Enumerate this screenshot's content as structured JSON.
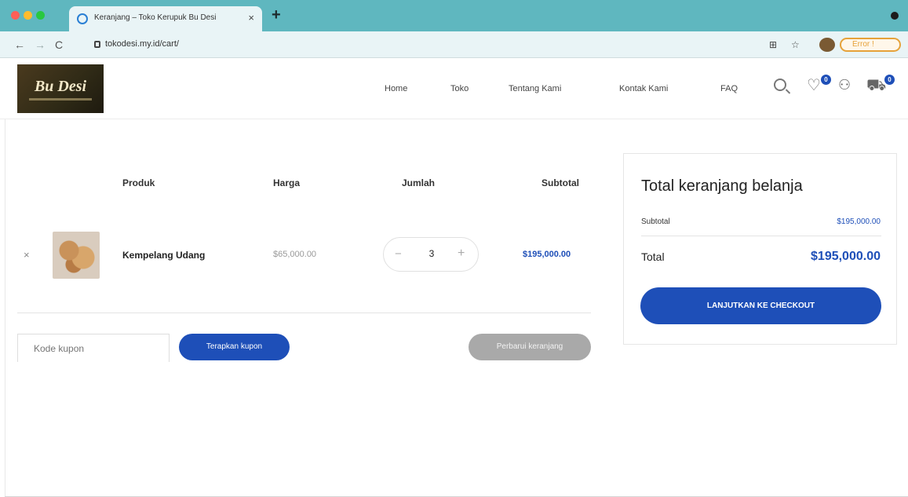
{
  "browser": {
    "tab_title": "Keranjang – Toko Kerupuk Bu Desi",
    "tab_close": "×",
    "new_tab": "+",
    "url": "tokodesi.my.id/cart/",
    "nav_back": "←",
    "nav_forward": "→",
    "nav_reload": "C",
    "error_label": "Error !",
    "icons": [
      "lock-icon",
      "translate-icon",
      "star-icon",
      "profile-avatar"
    ]
  },
  "header": {
    "logo_text": "Bu Desi",
    "menu": {
      "home": "Home",
      "toko": "Toko",
      "tentang": "Tentang Kami",
      "kontak": "Kontak Kami",
      "faq": "FAQ"
    },
    "wishlist_count": "0",
    "cart_count": "0",
    "icons": [
      "search-icon",
      "heart-icon",
      "user-icon",
      "cart-icon"
    ]
  },
  "cart": {
    "columns": {
      "product": "Produk",
      "price": "Harga",
      "quantity": "Jumlah",
      "subtotal": "Subtotal"
    },
    "items": [
      {
        "remove": "×",
        "name": "Kempelang Udang",
        "price": "$65,000.00",
        "quantity": "3",
        "minus": "−",
        "plus": "+",
        "subtotal": "$195,000.00"
      }
    ],
    "coupon_placeholder": "Kode kupon",
    "apply_coupon": "Terapkan kupon",
    "update_cart": "Perbarui keranjang"
  },
  "totals": {
    "title": "Total keranjang belanja",
    "subtotal_label": "Subtotal",
    "subtotal_value": "$195,000.00",
    "total_label": "Total",
    "total_value": "$195,000.00",
    "checkout": "LANJUTKAN KE CHECKOUT"
  },
  "colors": {
    "accent": "#1e4fb8",
    "tabbar": "#5fb7bf",
    "update_button": "#a9a9a9"
  }
}
